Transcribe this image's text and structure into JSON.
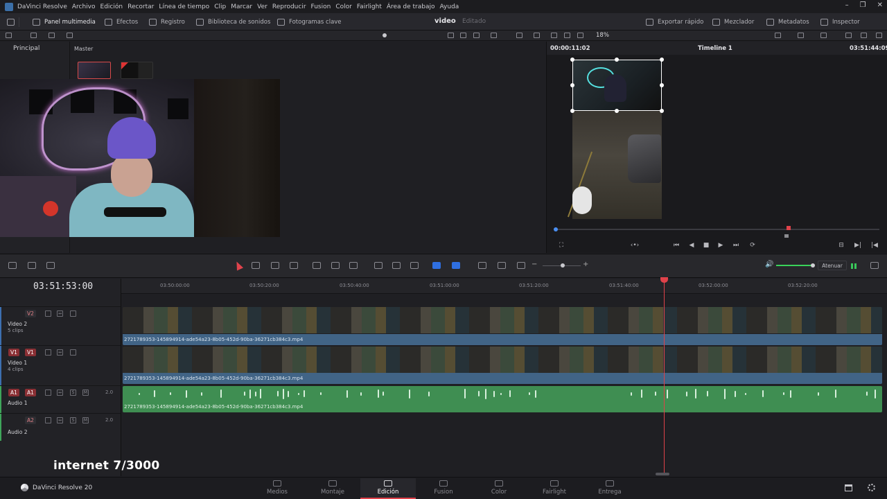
{
  "menubar": {
    "app_name": "DaVinci Resolve",
    "items": [
      "Archivo",
      "Edición",
      "Recortar",
      "Línea de tiempo",
      "Clip",
      "Marcar",
      "Ver",
      "Reproducir",
      "Fusion",
      "Color",
      "Fairlight",
      "Área de trabajo",
      "Ayuda"
    ],
    "window_buttons": [
      "–",
      "❐",
      "✕"
    ]
  },
  "toolbar": {
    "media_pool": "Panel multimedia",
    "effects": "Efectos",
    "index": "Registro",
    "sound_library": "Biblioteca de sonidos",
    "keyframes": "Fotogramas clave",
    "project_name": "video",
    "project_status": "Editado",
    "quick_export": "Exportar rápido",
    "mixer": "Mezclador",
    "metadata": "Metadatos",
    "inspector": "Inspector"
  },
  "viewer_bar": {
    "zoom": "18%"
  },
  "media_pool": {
    "bin_principal": "Principal",
    "bin_master": "Master"
  },
  "viewer": {
    "timecode_left": "00:00:11:02",
    "timeline_name": "Timeline 1",
    "timecode_right": "03:51:44:09"
  },
  "timeline_toolbar": {
    "attenuate": "Atenuar"
  },
  "timeline": {
    "timecode": "03:51:53:00",
    "ruler_labels": [
      "03:50:00:00",
      "03:50:20:00",
      "03:50:40:00",
      "03:51:00:00",
      "03:51:20:00",
      "03:51:40:00",
      "03:52:00:00",
      "03:52:20:00"
    ],
    "tracks": {
      "v2": {
        "badge": "V2",
        "name": "Video 2",
        "clips": "5 clips"
      },
      "v1": {
        "badge_a": "V1",
        "badge_b": "V1",
        "name": "Video 1",
        "clips": "4 clips"
      },
      "a1": {
        "badge_a": "A1",
        "badge_b": "A1",
        "name": "Audio 1",
        "level": "2.0"
      },
      "a2": {
        "badge": "A2",
        "name": "Audio 2",
        "level": "2.0"
      }
    },
    "clip_name": "2721789353-145894914-ade54a23-8b05-452d-90ba-36271cb384c3.mp4"
  },
  "overlay_text": "internet  7/3000",
  "pagebar": {
    "brand": "DaVinci Resolve 20",
    "pages": [
      "Medios",
      "Montaje",
      "Edición",
      "Fusion",
      "Color",
      "Fairlight",
      "Entrega"
    ],
    "active_page": "Edición"
  },
  "icons": [
    "davinci-logo-icon",
    "media-pool-icon",
    "effects-icon",
    "index-icon",
    "sound-library-icon",
    "keyframes-icon",
    "quick-export-icon",
    "mixer-icon",
    "metadata-icon",
    "inspector-icon",
    "select-tool-icon",
    "razor-icon",
    "link-icon",
    "lock-icon",
    "flag-icon",
    "marker-icon",
    "volume-icon",
    "home-icon",
    "gear-icon"
  ],
  "colors": {
    "accent_red": "#e0424a",
    "video_clip": "#416486",
    "audio_clip": "#3f8e52",
    "meter_green": "#39c75a"
  }
}
